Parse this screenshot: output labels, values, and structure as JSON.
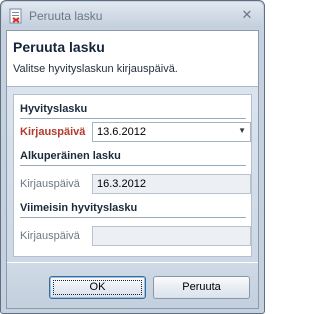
{
  "window": {
    "title": "Peruuta lasku"
  },
  "header": {
    "title": "Peruuta lasku",
    "subtitle": "Valitse hyvityslaskun kirjauspäivä."
  },
  "hyvityslasku": {
    "header": "Hyvityslasku",
    "label": "Kirjauspäivä",
    "value": "13.6.2012"
  },
  "alkuperainen": {
    "header": "Alkuperäinen lasku",
    "label": "Kirjauspäivä",
    "value": "16.3.2012"
  },
  "viimeisin": {
    "header": "Viimeisin hyvityslasku",
    "label": "Kirjauspäivä",
    "value": ""
  },
  "buttons": {
    "ok": "OK",
    "cancel": "Peruuta"
  },
  "colors": {
    "required_label": "#b23a2c",
    "section_header": "#1b2a3b"
  }
}
